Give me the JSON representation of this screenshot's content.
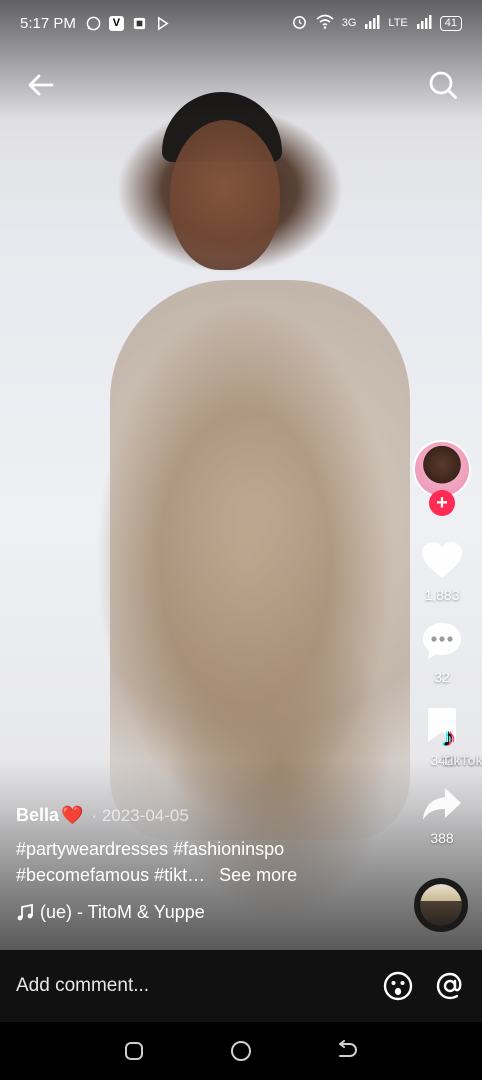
{
  "status_bar": {
    "time": "5:17 PM",
    "app_icons": [
      "whatsapp-icon",
      "v-app-icon",
      "office-icon",
      "media-icon"
    ],
    "network_3g": "3G",
    "network_lte": "LTE",
    "battery": "41"
  },
  "video": {
    "author": "Bella",
    "author_emoji": "❤️",
    "date": "· 2023-04-05",
    "hashtags_line1": "#partyweardresses #fashioninspo",
    "hashtags_line2": "#becomefamous #tikt…",
    "see_more": "See more",
    "music": "(ue) - TitoM & Yuppe",
    "watermark": "TikTok"
  },
  "actions": {
    "likes": "1,883",
    "comments": "32",
    "saves": "342",
    "shares": "388"
  },
  "comment_bar": {
    "placeholder": "Add comment..."
  },
  "colors": {
    "accent_red": "#fe2c55",
    "tiktok_cyan": "#25f4ee"
  }
}
